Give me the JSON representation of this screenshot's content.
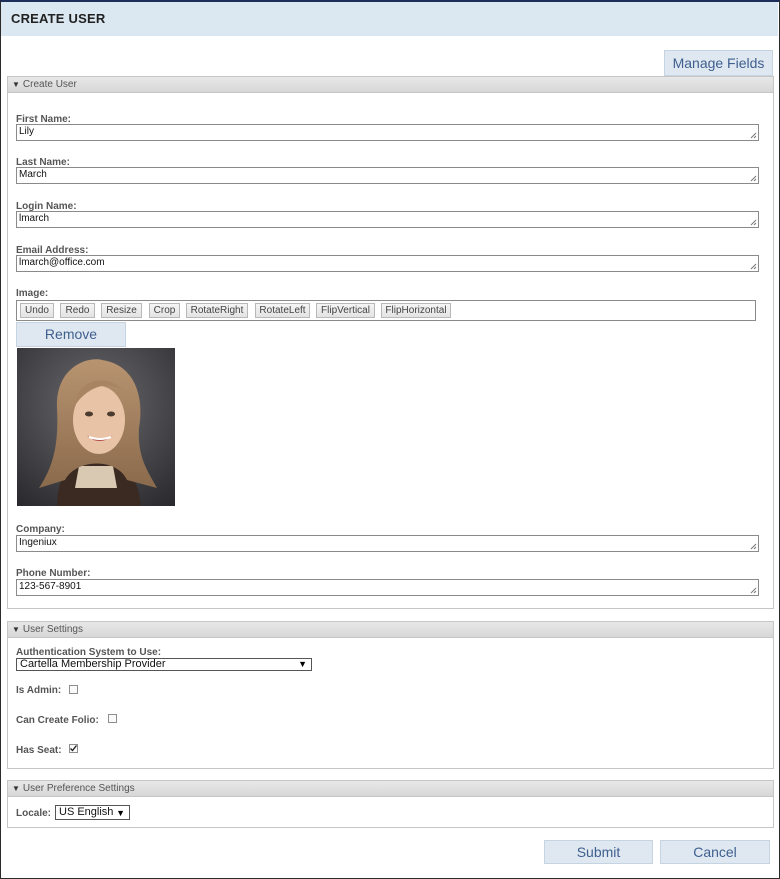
{
  "header": {
    "title": "CREATE USER"
  },
  "manage_fields_label": "Manage Fields",
  "create_user_section": {
    "title": "Create User",
    "fields": {
      "first_name": {
        "label": "First Name:",
        "value": "Lily"
      },
      "last_name": {
        "label": "Last Name:",
        "value": "March"
      },
      "login_name": {
        "label": "Login Name:",
        "value": "lmarch"
      },
      "email": {
        "label": "Email Address:",
        "value": "lmarch@office.com"
      },
      "company": {
        "label": "Company:",
        "value": "Ingeniux"
      },
      "phone": {
        "label": "Phone Number:",
        "value": "123-567-8901"
      }
    },
    "image": {
      "label": "Image:",
      "toolbar": [
        "Undo",
        "Redo",
        "Resize",
        "Crop",
        "RotateRight",
        "RotateLeft",
        "FlipVertical",
        "FlipHorizontal"
      ],
      "remove_label": "Remove"
    }
  },
  "user_settings_section": {
    "title": "User Settings",
    "auth_label": "Authentication System to Use:",
    "auth_value": "Cartella Membership Provider",
    "is_admin": {
      "label": "Is Admin:",
      "checked": false
    },
    "can_create_folio": {
      "label": "Can Create Folio:",
      "checked": false
    },
    "has_seat": {
      "label": "Has Seat:",
      "checked": true
    }
  },
  "preference_section": {
    "title": "User Preference Settings",
    "locale_label": "Locale:",
    "locale_value": "US English"
  },
  "footer": {
    "submit_label": "Submit",
    "cancel_label": "Cancel"
  },
  "colors": {
    "accent_text": "#3f5f8f",
    "button_bg": "#dfe8f1",
    "title_bar_bg": "#dbe7f1"
  }
}
